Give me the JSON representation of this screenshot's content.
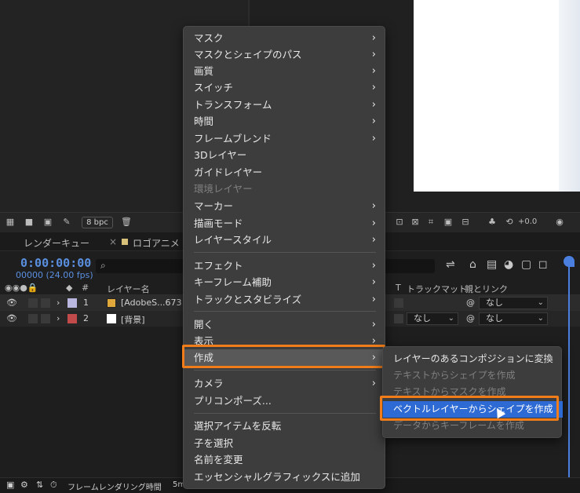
{
  "toolbar": {
    "bpc_label": "8 bpc",
    "exposure_value": "+0.0"
  },
  "timeline": {
    "tabs": [
      {
        "label": "レンダーキュー"
      },
      {
        "label": "ロゴアニメ"
      }
    ],
    "tab_close": "×",
    "timecode": "0:00:00:00",
    "fps_text": "00000 (24.00 fps)",
    "search_placeholder": "",
    "columns": {
      "layer_name": "レイヤー名",
      "hash": "#",
      "trackmatte_t": "T",
      "trackmatte": "トラックマット",
      "parent_link": "親とリンク"
    },
    "layers": [
      {
        "index": "1",
        "name": "[AdobeS...673",
        "color": "#b9b6e0",
        "parent": "なし"
      },
      {
        "index": "2",
        "name": "[背景]",
        "color": "#c24a4a",
        "trackmatte": "なし",
        "parent": "なし"
      }
    ],
    "status_text": "フレームレンダリング時間",
    "status_value": "5m"
  },
  "context_menu": {
    "items": [
      {
        "label": "マスク",
        "submenu": true
      },
      {
        "label": "マスクとシェイプのパス",
        "submenu": true
      },
      {
        "label": "画質",
        "submenu": true
      },
      {
        "label": "スイッチ",
        "submenu": true
      },
      {
        "label": "トランスフォーム",
        "submenu": true
      },
      {
        "label": "時間",
        "submenu": true
      },
      {
        "label": "フレームブレンド",
        "submenu": true
      },
      {
        "label": "3Dレイヤー",
        "submenu": false
      },
      {
        "label": "ガイドレイヤー",
        "submenu": false
      },
      {
        "label": "環境レイヤー",
        "submenu": false,
        "disabled": true
      },
      {
        "label": "マーカー",
        "submenu": true
      },
      {
        "label": "描画モード",
        "submenu": true
      },
      {
        "label": "レイヤースタイル",
        "submenu": true
      },
      {
        "label": "エフェクト",
        "submenu": true
      },
      {
        "label": "キーフレーム補助",
        "submenu": true
      },
      {
        "label": "トラックとスタビライズ",
        "submenu": true
      },
      {
        "label": "開く",
        "submenu": true
      },
      {
        "label": "表示",
        "submenu": true
      },
      {
        "label": "作成",
        "submenu": true
      },
      {
        "label": "カメラ",
        "submenu": true
      },
      {
        "label": "プリコンポーズ...",
        "submenu": false
      },
      {
        "label": "選択アイテムを反転",
        "submenu": false
      },
      {
        "label": "子を選択",
        "submenu": false
      },
      {
        "label": "名前を変更",
        "submenu": false
      },
      {
        "label": "エッセンシャルグラフィックスに追加",
        "submenu": false
      }
    ]
  },
  "create_submenu": {
    "items": [
      {
        "label": "レイヤーのあるコンポジションに変換",
        "disabled": false
      },
      {
        "label": "テキストからシェイプを作成",
        "disabled": true
      },
      {
        "label": "テキストからマスクを作成",
        "disabled": true
      },
      {
        "label": "ベクトルレイヤーからシェイプを作成",
        "disabled": false,
        "selected": true
      },
      {
        "label": "データからキーフレームを作成",
        "disabled": true
      }
    ]
  },
  "colors": {
    "highlight_orange": "#f07d19",
    "selection_blue": "#2d6ad4",
    "timecode_blue": "#5a8fe0"
  }
}
